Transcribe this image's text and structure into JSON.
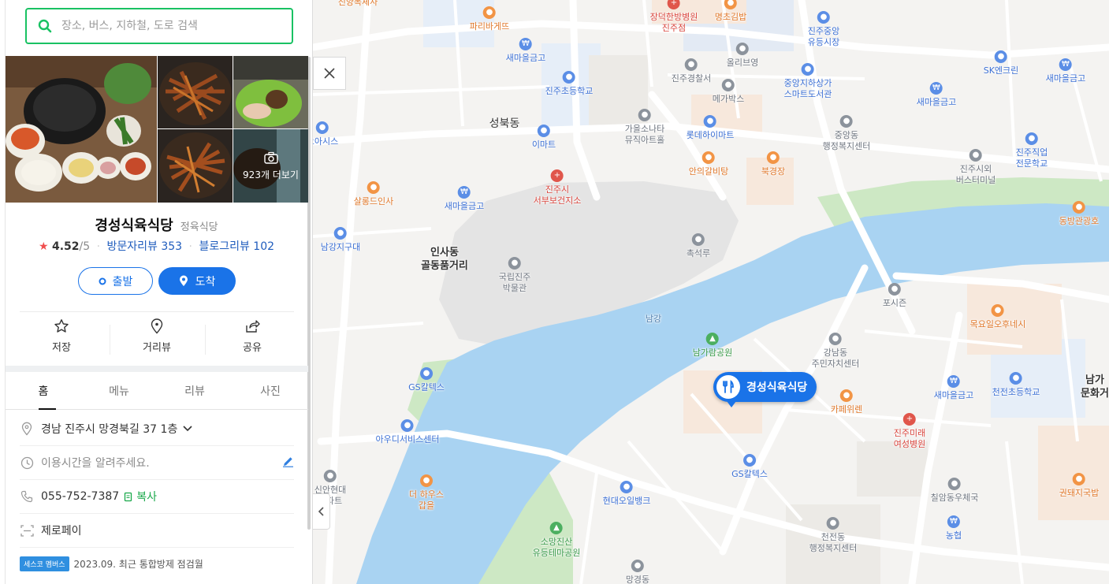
{
  "search": {
    "placeholder": "장소, 버스, 지하철, 도로 검색"
  },
  "photos": {
    "more_label": "923개 더보기"
  },
  "place": {
    "name": "경성식육식당",
    "category": "정육식당",
    "rating": "4.52",
    "rating_scale": "/5",
    "visitor_reviews_label": "방문자리뷰 353",
    "blog_reviews_label": "블로그리뷰 102"
  },
  "route": {
    "depart_label": "출발",
    "arrive_label": "도착"
  },
  "actions": {
    "save_label": "저장",
    "streetview_label": "거리뷰",
    "share_label": "공유"
  },
  "tabs": [
    {
      "label": "홈",
      "active": true
    },
    {
      "label": "메뉴",
      "active": false
    },
    {
      "label": "리뷰",
      "active": false
    },
    {
      "label": "사진",
      "active": false
    }
  ],
  "info": {
    "address": "경남 진주시 망경북길 37 1층",
    "hours": "이용시간을 알려주세요.",
    "phone": "055-752-7387",
    "copy_label": "복사",
    "payment": "제로페이",
    "badge": "세스코 멤버스",
    "inspection": "2023.09. 최근 통합방제 점검월"
  },
  "map": {
    "marker_label": "경성식육식당",
    "labels": [
      {
        "text": "진양복체사",
        "kind": "orange"
      },
      {
        "text": "파리바게뜨",
        "kind": "orange"
      },
      {
        "text": "장덕한방병원\n진주점",
        "kind": "red"
      },
      {
        "text": "명초김밥",
        "kind": "orange"
      },
      {
        "text": "진주중앙\n유등시장",
        "kind": "blue"
      },
      {
        "text": "새마을금고",
        "kind": "blue"
      },
      {
        "text": "올리브영",
        "kind": "gray"
      },
      {
        "text": "SK엔크린",
        "kind": "blue"
      },
      {
        "text": "새마을금고",
        "kind": "blue"
      },
      {
        "text": "진주경찰서",
        "kind": "gray"
      },
      {
        "text": "진주초등학교",
        "kind": "blue"
      },
      {
        "text": "메가박스",
        "kind": "gray"
      },
      {
        "text": "중앙지하상가\n스마트도서관",
        "kind": "blue"
      },
      {
        "text": "새마을금고",
        "kind": "blue"
      },
      {
        "text": "성북동",
        "kind": "dark"
      },
      {
        "text": "가을소나타\n뮤직아트홀",
        "kind": "gray"
      },
      {
        "text": "이마트",
        "kind": "blue"
      },
      {
        "text": "롯데하이마트",
        "kind": "blue"
      },
      {
        "text": "중앙동\n행정복지센터",
        "kind": "gray"
      },
      {
        "text": "진주직업\n전문학교",
        "kind": "blue"
      },
      {
        "text": "오아시스",
        "kind": "blue"
      },
      {
        "text": "안의갈비탕",
        "kind": "orange"
      },
      {
        "text": "북경장",
        "kind": "orange"
      },
      {
        "text": "진주시외\n버스터미널",
        "kind": "gray"
      },
      {
        "text": "진주시\n서부보건지소",
        "kind": "red"
      },
      {
        "text": "살롱드인사",
        "kind": "orange"
      },
      {
        "text": "새마을금고",
        "kind": "blue"
      },
      {
        "text": "동방관광호",
        "kind": "orange"
      },
      {
        "text": "촉석루",
        "kind": "gray"
      },
      {
        "text": "남강지구대",
        "kind": "blue"
      },
      {
        "text": "인사동\n골동품거리",
        "kind": "big"
      },
      {
        "text": "국립진주\n박물관",
        "kind": "gray"
      },
      {
        "text": "포시즌",
        "kind": "gray"
      },
      {
        "text": "남강",
        "kind": "river"
      },
      {
        "text": "목요일오후네시",
        "kind": "orange"
      },
      {
        "text": "남가람공원",
        "kind": "green"
      },
      {
        "text": "강남동\n주민자치센터",
        "kind": "gray"
      },
      {
        "text": "GS칼텍스",
        "kind": "blue"
      },
      {
        "text": "카페위렌",
        "kind": "orange"
      },
      {
        "text": "새마을금고",
        "kind": "blue"
      },
      {
        "text": "천전초등학교",
        "kind": "blue"
      },
      {
        "text": "남가\n문화거",
        "kind": "big"
      },
      {
        "text": "아우디서비스센터",
        "kind": "blue"
      },
      {
        "text": "진주미래\n여성병원",
        "kind": "red"
      },
      {
        "text": "GS칼텍스",
        "kind": "blue"
      },
      {
        "text": "더 하우스\n갑을",
        "kind": "orange"
      },
      {
        "text": "신안현대\n아파트",
        "kind": "gray"
      },
      {
        "text": "현대오일뱅크",
        "kind": "blue"
      },
      {
        "text": "칠암동우체국",
        "kind": "gray"
      },
      {
        "text": "권돼지국밥",
        "kind": "orange"
      },
      {
        "text": "소망진산\n유등테마공원",
        "kind": "green"
      },
      {
        "text": "천전동\n행정복지센터",
        "kind": "gray"
      },
      {
        "text": "농협",
        "kind": "blue"
      },
      {
        "text": "망경동",
        "kind": "gray"
      }
    ]
  },
  "colors": {
    "accent": "#1a73e8",
    "search_border": "#19c263",
    "rating_star": "#f04e4e",
    "review_link": "#1f5cbd",
    "copy_green": "#19a84a",
    "river": "#a9d3f2",
    "park": "#cde8c4"
  }
}
